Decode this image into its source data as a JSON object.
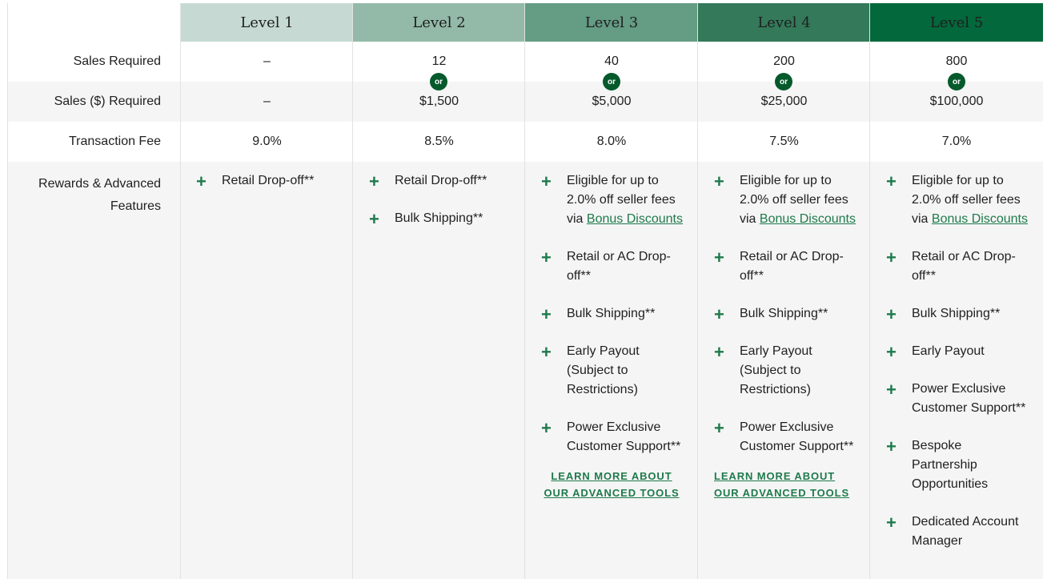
{
  "levels": [
    {
      "name": "Level 1",
      "color": "#c6dad3",
      "sales": "–",
      "sales_usd": "–",
      "fee": "9.0%"
    },
    {
      "name": "Level 2",
      "color": "#93baa8",
      "sales": "12",
      "sales_usd": "$1,500",
      "fee": "8.5%"
    },
    {
      "name": "Level 3",
      "color": "#649c84",
      "sales": "40",
      "sales_usd": "$5,000",
      "fee": "8.0%"
    },
    {
      "name": "Level 4",
      "color": "#33795a",
      "sales": "200",
      "sales_usd": "$25,000",
      "fee": "7.5%"
    },
    {
      "name": "Level 5",
      "color": "#03683b",
      "sales": "800",
      "sales_usd": "$100,000",
      "fee": "7.0%"
    }
  ],
  "labels": {
    "sales": "Sales Required",
    "sales_usd": "Sales ($) Required",
    "fee": "Transaction Fee",
    "rewards_1": "Rewards & Advanced",
    "rewards_2": "Features"
  },
  "or_text": "or",
  "rewards": {
    "l1": [
      "Retail Drop-off**"
    ],
    "l2": [
      "Retail Drop-off**",
      "Bulk Shipping**"
    ],
    "common": {
      "bonus_pre": "Eligible for up to 2.0% off seller fees via ",
      "bonus_link": "Bonus Discounts",
      "retail_ac": "Retail or AC Drop-off**",
      "bulk": "Bulk Shipping**",
      "early": "Early Payout (Subject to Restrictions)",
      "early5": "Early Payout",
      "power": "Power Exclusive Customer Support**",
      "bespoke": "Bespoke Partnership Opportunities",
      "dedicated": "Dedicated Account Manager"
    },
    "learn_1": "LEARN MORE ABOUT",
    "learn_2": "OUR ADVANCED TOOLS"
  }
}
